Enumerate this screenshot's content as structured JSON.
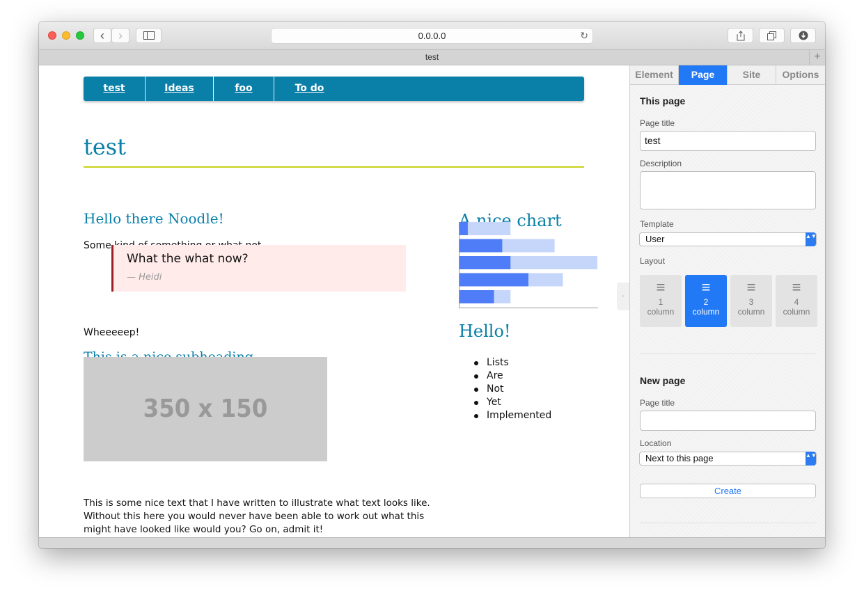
{
  "browser": {
    "url": "0.0.0.0",
    "tab_title": "test",
    "back_glyph": "‹",
    "forward_glyph": "›",
    "reload_glyph": "↻",
    "tab_add_glyph": "+"
  },
  "site": {
    "nav": [
      "test",
      "Ideas",
      "foo",
      "To do"
    ],
    "page_title": "test",
    "heading1": "Hello there Noodle!",
    "para1": "Some kind of something or what not.",
    "quote_text": "What the what now?",
    "quote_cite": "— Heidi",
    "para2": "Wheeeeep!",
    "subheading": "This is a nice subheading",
    "placeholder_label": "350 x 150",
    "para3_lines": [
      "This is some nice text that I have written to illustrate what text looks like.",
      "Without this here you would never have been able to work out what this",
      "might have looked like would you? Go on, admit it!"
    ],
    "chart_heading": "A nice chart",
    "list_heading": "Hello!",
    "list_items": [
      "Lists",
      "Are",
      "Not",
      "Yet",
      "Implemented"
    ]
  },
  "chart_data": {
    "type": "bar",
    "orientation": "horizontal",
    "categories": [
      "",
      "",
      "",
      "",
      ""
    ],
    "series": [
      {
        "values": [
          6,
          31,
          37,
          50,
          25
        ],
        "color": "#4f7cf7"
      },
      {
        "values": [
          37,
          69,
          100,
          75,
          37
        ],
        "color": "#c6d6fb"
      }
    ],
    "xlim": [
      0,
      100
    ]
  },
  "panel": {
    "tabs": [
      "Element",
      "Page",
      "Site",
      "Options"
    ],
    "active_tab": "Page",
    "this_page_heading": "This page",
    "page_title_label": "Page title",
    "page_title_value": "test",
    "description_label": "Description",
    "description_value": "",
    "template_label": "Template",
    "template_value": "User",
    "layout_label": "Layout",
    "layout_options": [
      {
        "num": "1",
        "word": "column"
      },
      {
        "num": "2",
        "word": "column"
      },
      {
        "num": "3",
        "word": "column"
      },
      {
        "num": "4",
        "word": "column"
      }
    ],
    "layout_selected": "2",
    "new_page_heading": "New page",
    "new_page_title_label": "Page title",
    "new_page_title_value": "",
    "location_label": "Location",
    "location_value": "Next to this page",
    "create_label": "Create",
    "handle_glyph": "›",
    "select_arrows": "▲▼"
  },
  "colors": {
    "accent": "#0a7fa8",
    "rule": "#c8d21a",
    "panel_active": "#2279f5",
    "quote_bg": "#ffebea",
    "quote_border": "#9a1e22"
  }
}
